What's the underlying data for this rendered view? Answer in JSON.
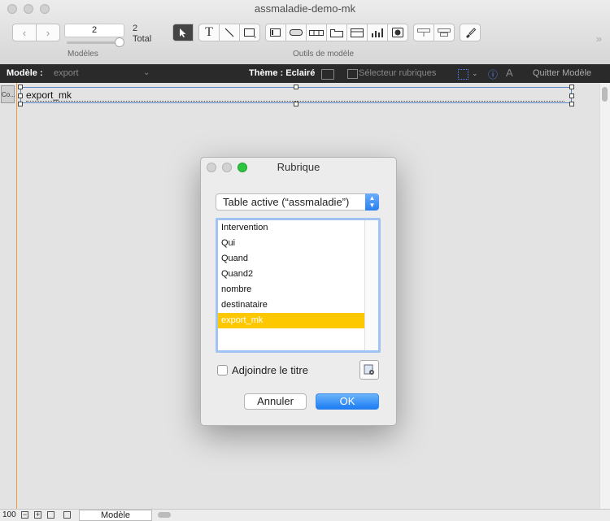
{
  "window": {
    "title": "assmaladie-demo-mk"
  },
  "toolbar": {
    "layout_number": "2",
    "total_count": "2",
    "total_label": "Total",
    "models_label": "Modèles",
    "tools_label": "Outils de modèle",
    "tools": [
      "pointer-tool",
      "text-tool",
      "line-tool",
      "rectangle-tool",
      "field-tool",
      "button-tool",
      "button-bar-tool",
      "tab-control-tool",
      "slide-control-tool",
      "chart-tool",
      "web-viewer-tool",
      "portal-tool",
      "popover-tool",
      "format-painter-tool"
    ]
  },
  "layoutbar": {
    "model_label": "Modèle :",
    "model_value": "export",
    "theme_label": "Thème : Eclairé",
    "field_picker_label": "Sélecteur rubriques",
    "quit_label": "Quitter Modèle"
  },
  "canvas": {
    "field_name": "export_mk",
    "part_label": "Co..."
  },
  "statusbar": {
    "zoom": "100",
    "mode": "Modèle"
  },
  "dialog": {
    "title": "Rubrique",
    "table_select": "Table active (“assmaladie”)",
    "fields": [
      "Intervention",
      "Qui",
      "Quand",
      "Quand2",
      "nombre",
      "destinataire",
      "export_mk"
    ],
    "selected_field": "export_mk",
    "add_title_label": "Adjoindre le titre",
    "add_title_checked": false,
    "cancel_label": "Annuler",
    "ok_label": "OK"
  }
}
